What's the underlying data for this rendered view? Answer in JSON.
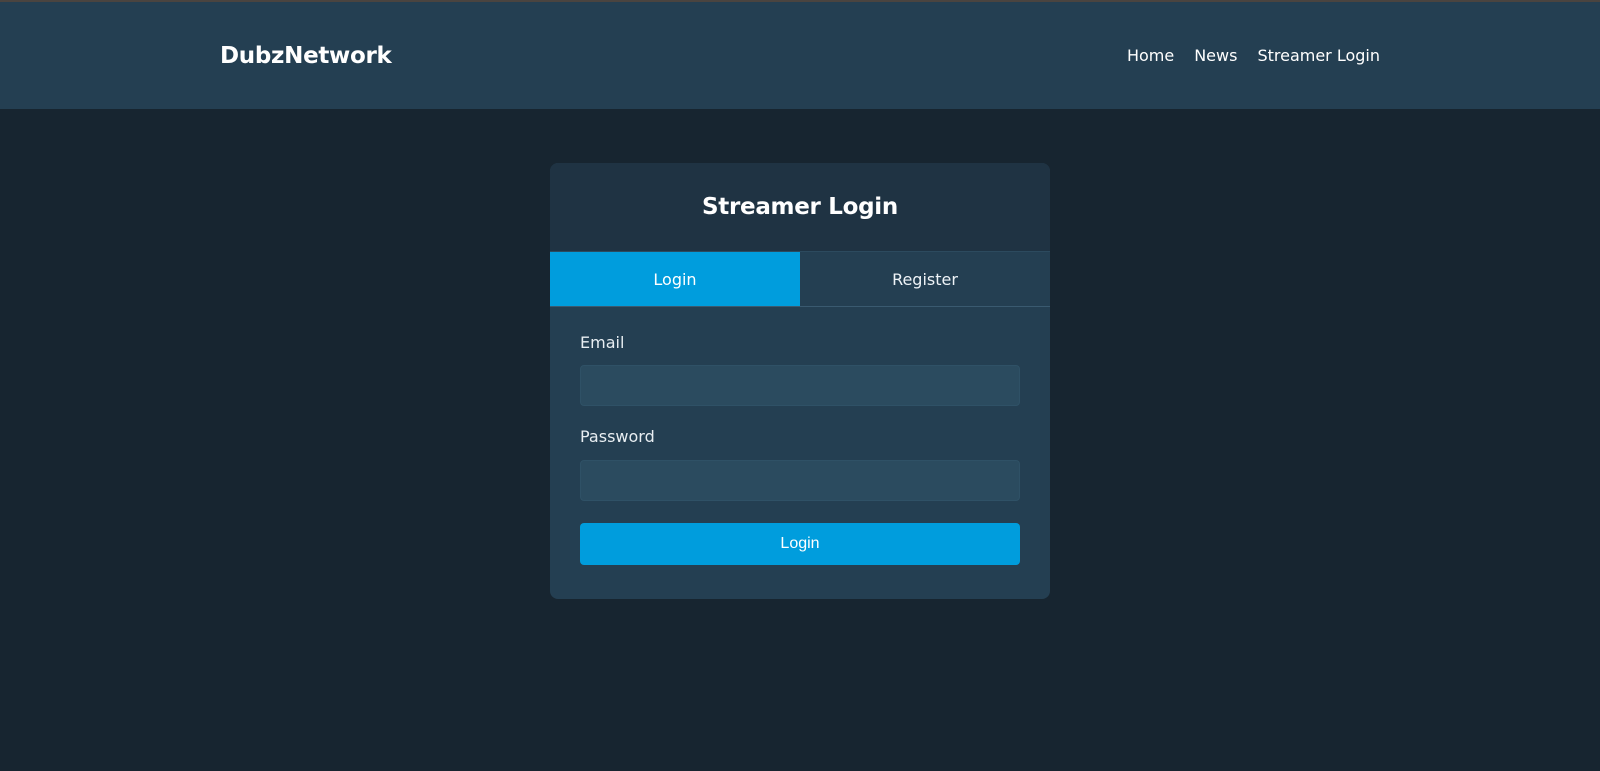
{
  "navbar": {
    "brand": "DubzNetwork",
    "links": [
      {
        "label": "Home"
      },
      {
        "label": "News"
      },
      {
        "label": "Streamer Login"
      }
    ]
  },
  "card": {
    "title": "Streamer Login",
    "tabs": [
      {
        "label": "Login",
        "active": true
      },
      {
        "label": "Register",
        "active": false
      }
    ],
    "form": {
      "email_label": "Email",
      "email_value": "",
      "password_label": "Password",
      "password_value": "",
      "submit_label": "Login"
    }
  },
  "colors": {
    "background": "#172530",
    "navbar": "#243f52",
    "card_header": "#1f3343",
    "card_body": "#243f52",
    "accent": "#009ddd",
    "input_bg": "#2b4b5f"
  }
}
